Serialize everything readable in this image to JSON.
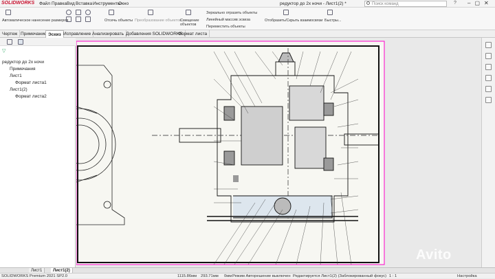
{
  "app": {
    "logo": "SOLIDWORKS",
    "document_title": "редуктор до 2х ночи - Лист1(2) *"
  },
  "menu": [
    "Файл",
    "Правка",
    "Вид",
    "Вставка",
    "Инструменты",
    "Окно"
  ],
  "search": {
    "placeholder": "Поиск команд"
  },
  "ribbon": {
    "auto_dim": "Автоматическое нанесение размеров",
    "offset": "Отсечь объекты",
    "convert": "Преобразование объектов",
    "offset_entities": "Смещение объектов",
    "mirror": "Зеркально отразить объекты",
    "linear_pattern": "Линейный массив эскиза",
    "move": "Переместить объекты",
    "show_hide": "Отобразить/Скрыть взаимосвязи",
    "quick": "Быстры..."
  },
  "tabs": [
    "Чертеж",
    "Примечание",
    "Эскиз",
    "Исправление",
    "Анализировать",
    "Добавления SOLIDWORKS",
    "Формат листа"
  ],
  "active_tab": "Эскиз",
  "tree": {
    "root": "редуктор до 2х ночи",
    "items": [
      "Примечания",
      "Лист1",
      "Формат листа1",
      "Лист1(2)",
      "Формат листа2"
    ]
  },
  "sheet_tabs": [
    "Лист1",
    "Лист1(2)"
  ],
  "active_sheet": "Лист1(2)",
  "status": {
    "version": "SOLIDWORKS Premium 2021 SP2.0",
    "x": "1115.86мм",
    "y": "293.71мм",
    "z": "0мм",
    "mode": "Режим Авторешение выключен",
    "editing": "Редактируется Лист1(2) (Заблокированный фокус)",
    "scale": "1 : 1",
    "settings": "Настройка"
  },
  "watermark": "Avito",
  "colors": {
    "accent": "#c8102e",
    "sheet_border": "#ff00cc",
    "drawing": "#111111"
  }
}
